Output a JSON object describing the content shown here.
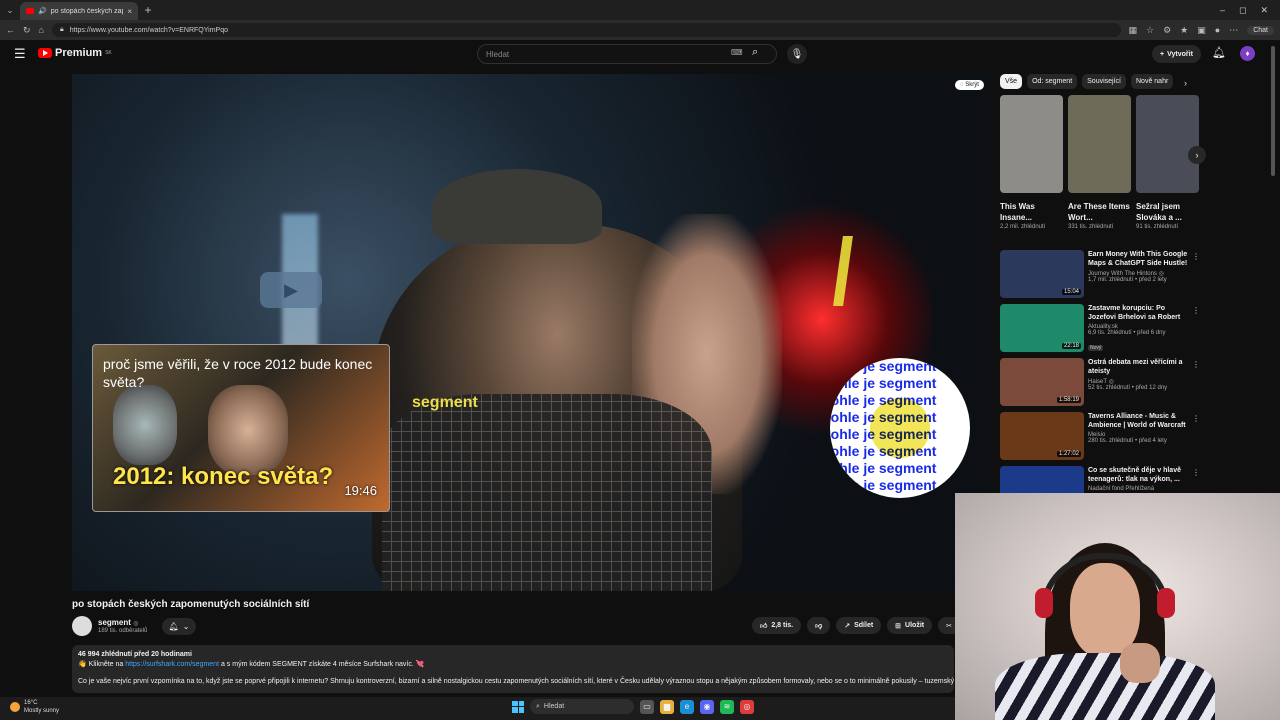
{
  "browser": {
    "tab_title": "po stopách českých zapomen",
    "tab_close": "×",
    "new_tab": "+",
    "url": "https://www.youtube.com/watch?v=ENRFQYimPqo",
    "chat_label": "Chat",
    "win_controls": [
      "–",
      "◻",
      "✕"
    ]
  },
  "header": {
    "logo": "Premium",
    "logo_sup": "SK",
    "search_placeholder": "Hledat",
    "create_label": "Vytvořit"
  },
  "player": {
    "hide_label": "Skrýt",
    "shirt_text": "segment",
    "endcard": {
      "title": "proč jsme věřili, že v roce 2012 bude konec světa?",
      "big_text": "2012: konec světa?",
      "duration": "19:46"
    },
    "circle_lines": [
      "tohle je segment",
      "tohle je segment",
      "tohle je segment",
      "tohle je segment",
      "tohle je segment",
      "tohle je segment",
      "tohle je segment",
      "tohle je segment"
    ]
  },
  "video": {
    "title": "po stopách českých zapomenutých sociálních sítí",
    "channel": "segment",
    "verified": "◎",
    "subs": "189 tis. odběratelů",
    "likes": "2,8 tis.",
    "share": "Sdílet",
    "save": "Uložit",
    "clip": "K"
  },
  "description": {
    "meta": "46 994 zhlédnutí  před 20 hodinami",
    "line1_pre": "👋 Klikněte na ",
    "line1_link": "https://surfshark.com/segment",
    "line1_post": " a s mým kódem SEGMENT získáte 4 měsíce Surfshark navíc. 💘",
    "body": "Co je vaše nejvíc první vzpomínka na to, když jste se poprvé připojili k internetu? Shrnuju kontroverzní, bizarní a silně nostalgickou cestu zapomenutých sociálních sítí, které v Česku udělaly výraznou stopu a nějakým způsobem formovaly, nebo se o to minimálně pokusily – tuzemský internet"
  },
  "chips": [
    "Vše",
    "Od: segment",
    "Související",
    "Nově nahr"
  ],
  "shorts": [
    {
      "title": "This Was Insane... ",
      "views": "2,2 mil. zhlédnutí",
      "color": "#8e8c86"
    },
    {
      "title": "Are These Items Wort...",
      "views": "331 tis. zhlédnutí",
      "color": "#6e6a58"
    },
    {
      "title": "Sežral jsem Slováka a ...",
      "views": "91 tis. zhlédnutí",
      "color": "#4a4d58"
    }
  ],
  "recs": [
    {
      "title": "Earn Money With This Google Maps & ChatGPT Side Hustle!",
      "channel": "Journey With The Hintons ◎",
      "views": "1,7 mil. zhlédnutí • před 2 lety",
      "duration": "15:04",
      "color": "#2b3a5c",
      "badge": ""
    },
    {
      "title": "Zastavme korupciu: Po Jozefovi Brhelovi sa Robert Fico zjavil p...",
      "channel": "Aktuality.sk",
      "views": "6,9 tis. zhlédnutí • před 6 dny",
      "duration": "22:18",
      "color": "#1f8a6a",
      "badge": "Nový"
    },
    {
      "title": "Ostrá debata mezi věřícími a ateisty",
      "channel": "HaiseT ◎",
      "views": "52 tis. zhlédnutí • před 12 dny",
      "duration": "1:58:19",
      "color": "#7c4a3a",
      "badge": ""
    },
    {
      "title": "Taverns Alliance - Music & Ambience | World of Warcraft",
      "channel": "Meisio",
      "views": "280 tis. zhlédnutí • před 4 lety",
      "duration": "1:27:02",
      "color": "#6a3a18",
      "badge": ""
    },
    {
      "title": "Co se skutečně děje v hlavě teenagerů: tlak na výkon, ...",
      "channel": "Nadační fond Přehlížená",
      "views": "",
      "duration": "",
      "color": "#1c3a8a",
      "badge": ""
    }
  ],
  "taskbar": {
    "temp": "16°C",
    "weather": "Mostly sunny",
    "search": "Hledat"
  }
}
